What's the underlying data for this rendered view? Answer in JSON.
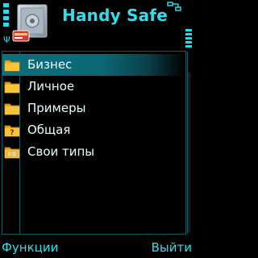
{
  "app": {
    "title": "Handy Safe"
  },
  "status": {
    "signal_icon": "signal-strength-icon",
    "battery_icon": "battery-level-icon",
    "connection_icon": "connectivity-icon"
  },
  "list": {
    "items": [
      {
        "label": "Бизнес",
        "icon": "folder-icon",
        "selected": true
      },
      {
        "label": "Личное",
        "icon": "folder-icon",
        "selected": false
      },
      {
        "label": "Примеры",
        "icon": "folder-icon",
        "selected": false
      },
      {
        "label": "Общая",
        "icon": "folder-question-icon",
        "selected": false
      },
      {
        "label": "Свои типы",
        "icon": "folder-custom-types-icon",
        "selected": false
      }
    ]
  },
  "softkeys": {
    "left": "Функции",
    "right": "Выйти"
  },
  "colors": {
    "accent": "#2ce0ee",
    "selection": "#0c6f7c",
    "background": "#000000"
  }
}
